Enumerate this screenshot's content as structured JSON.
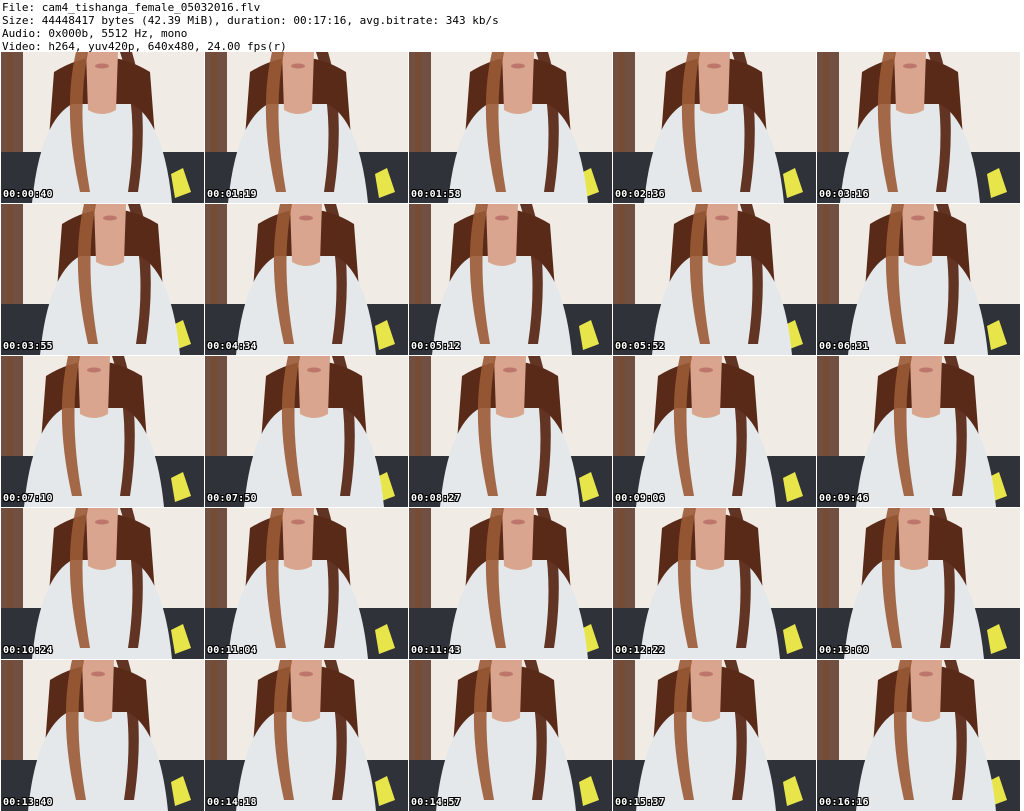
{
  "header": {
    "file": "File: cam4_tishanga_female_05032016.flv",
    "size": "Size: 44448417 bytes (42.39 MiB), duration: 00:17:16, avg.bitrate: 343 kb/s",
    "audio": "Audio: 0x000b, 5512 Hz, mono",
    "video": "Video: h264, yuv420p, 640x480, 24.00 fps(r)"
  },
  "thumbnails": [
    {
      "timestamp": "00:00:40",
      "variant": "a"
    },
    {
      "timestamp": "00:01:19",
      "variant": "b"
    },
    {
      "timestamp": "00:01:58",
      "variant": "c"
    },
    {
      "timestamp": "00:02:36",
      "variant": "a"
    },
    {
      "timestamp": "00:03:16",
      "variant": "b"
    },
    {
      "timestamp": "00:03:55",
      "variant": "c"
    },
    {
      "timestamp": "00:04:34",
      "variant": "a"
    },
    {
      "timestamp": "00:05:12",
      "variant": "b"
    },
    {
      "timestamp": "00:05:52",
      "variant": "c"
    },
    {
      "timestamp": "00:06:31",
      "variant": "a"
    },
    {
      "timestamp": "00:07:10",
      "variant": "b"
    },
    {
      "timestamp": "00:07:50",
      "variant": "c"
    },
    {
      "timestamp": "00:08:27",
      "variant": "a"
    },
    {
      "timestamp": "00:09:06",
      "variant": "b"
    },
    {
      "timestamp": "00:09:46",
      "variant": "c"
    },
    {
      "timestamp": "00:10:24",
      "variant": "a"
    },
    {
      "timestamp": "00:11:04",
      "variant": "b"
    },
    {
      "timestamp": "00:11:43",
      "variant": "c"
    },
    {
      "timestamp": "00:12:22",
      "variant": "d"
    },
    {
      "timestamp": "00:13:00",
      "variant": "d"
    },
    {
      "timestamp": "00:13:40",
      "variant": "d"
    },
    {
      "timestamp": "00:14:18",
      "variant": "a"
    },
    {
      "timestamp": "00:14:57",
      "variant": "d"
    },
    {
      "timestamp": "00:15:37",
      "variant": "b"
    },
    {
      "timestamp": "00:16:16",
      "variant": "c"
    }
  ],
  "colors": {
    "wall": "#f1ebe6",
    "shirt": "#e4e8ea",
    "hair": "#5a2a18",
    "hair_light": "#9a5a35",
    "skin": "#d9a58e",
    "sofa": "#2f3238",
    "door_frame": "#5b3524",
    "accent_yellow": "#e8e54a"
  }
}
